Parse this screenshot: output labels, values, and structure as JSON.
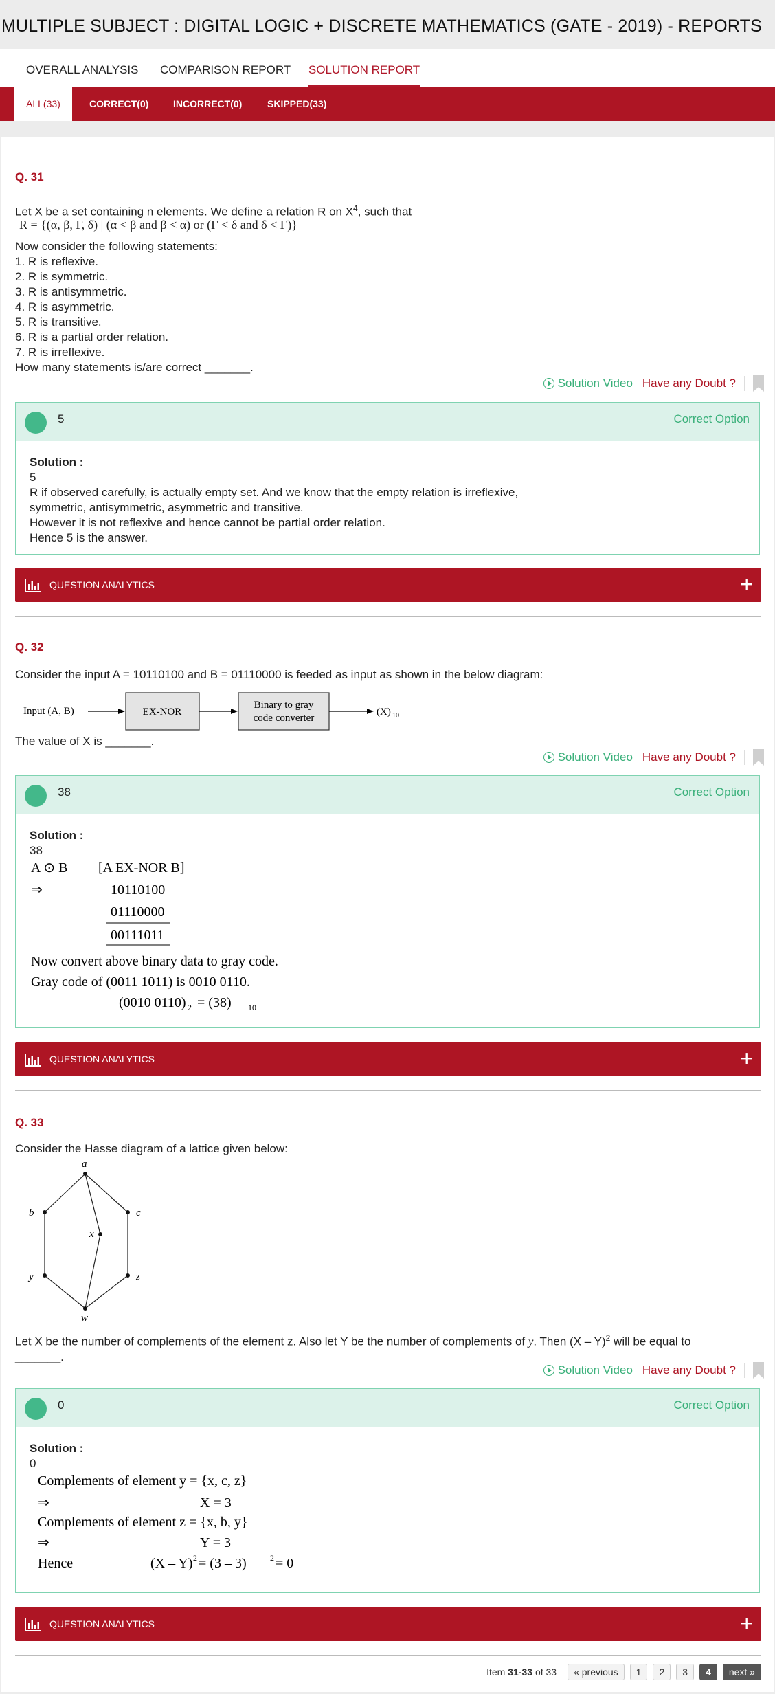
{
  "header": {
    "title": "MULTIPLE SUBJECT : DIGITAL LOGIC + DISCRETE MATHEMATICS (GATE - 2019) - REPORTS"
  },
  "tabs": [
    "OVERALL ANALYSIS",
    "COMPARISON REPORT",
    "SOLUTION REPORT"
  ],
  "filters": [
    "ALL(33)",
    "CORRECT(0)",
    "INCORRECT(0)",
    "SKIPPED(33)"
  ],
  "common": {
    "solution_video": "Solution Video",
    "have_doubt": "Have any Doubt ?",
    "correct_option": "Correct Option",
    "solution_label": "Solution :",
    "question_analytics": "QUESTION ANALYTICS",
    "plus": "+"
  },
  "q31": {
    "num": "Q. 31",
    "intro": "Let X be a set containing n elements. We define a relation R on X",
    "intro_sup": "4",
    "intro_end": ", such that",
    "relation": "R = {(α, β, Γ, δ) | (α < β and β < α) or (Γ < δ and δ < Γ)}",
    "lines": [
      "Now consider the following statements:",
      "1. R is reflexive.",
      "2. R is symmetric.",
      "3. R is antisymmetric.",
      "4. R is asymmetric.",
      "5. R is transitive.",
      "6. R is a partial order relation.",
      "7. R is irreflexive.",
      "How many statements is/are correct _______."
    ],
    "answer": "5",
    "solution": [
      "5",
      "R if observed carefully, is actually empty set. And we know that the empty relation is irreflexive,",
      "symmetric, antisymmetric, asymmetric and transitive.",
      "However it is not reflexive and hence cannot be partial order relation.",
      "Hence 5 is the answer."
    ]
  },
  "q32": {
    "num": "Q. 32",
    "intro": "Consider the input A = 10110100 and B = 01110000 is feeded as input as shown in the below diagram:",
    "diagram": {
      "input": "Input (A, B)",
      "box1": "EX-NOR",
      "box2_line1": "Binary to gray",
      "box2_line2": "code converter",
      "output": "(X)",
      "output_sub": "10"
    },
    "question": "The value of X is _______.",
    "answer": "38",
    "solution_value": "38",
    "work": {
      "op": "A ⊙ B",
      "op_desc": "[A EX-NOR B]",
      "arrow": "⇒",
      "row1": "10110100",
      "row2": "01110000",
      "result": "00111011",
      "line1": "Now convert above binary data to gray code.",
      "line2": "Gray code of (0011 1011) is 0010 0110.",
      "line3_a": "(0010 0110)",
      "line3_sub1": "2",
      "line3_b": " = (38)",
      "line3_sub2": "10"
    }
  },
  "q33": {
    "num": "Q. 33",
    "intro": "Consider the Hasse diagram of a lattice given below:",
    "nodes": {
      "a": "a",
      "b": "b",
      "c": "c",
      "x": "x",
      "y": "y",
      "z": "z",
      "w": "w"
    },
    "question_a": "Let X be the number of complements of the element z. Also let Y be the number of complements of ",
    "question_y": "y",
    "question_b": ". Then (X – Y)",
    "question_sup": "2",
    "question_c": " will be equal to",
    "question_blank": "_______.",
    "answer": "0",
    "solution_value": "0",
    "work": {
      "l1": "Complements of element y = {x, c, z}",
      "arrow": "⇒",
      "l2": "X = 3",
      "l3": "Complements of element z = {x, b, y}",
      "l4": "Y = 3",
      "hence": "Hence",
      "l5a": "(X – Y)",
      "l5sup": "2",
      "l5b": " = (3 – 3)",
      "l5sup2": "2",
      "l5c": " = 0"
    }
  },
  "pager": {
    "item": "Item",
    "range": "31-33",
    "of": "of 33",
    "prev": "« previous",
    "pages": [
      "1",
      "2",
      "3",
      "4"
    ],
    "next": "next »"
  }
}
